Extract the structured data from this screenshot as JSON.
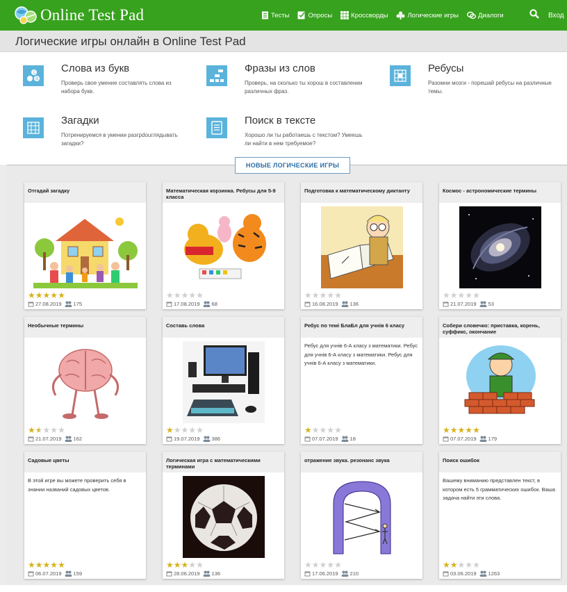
{
  "header": {
    "logo_text": "Online Test Pad",
    "nav": [
      {
        "label": "Тесты",
        "icon": "document-icon"
      },
      {
        "label": "Опросы",
        "icon": "poll-icon"
      },
      {
        "label": "Кроссворды",
        "icon": "grid-icon"
      },
      {
        "label": "Логические игры",
        "icon": "puzzle-icon"
      },
      {
        "label": "Диалоги",
        "icon": "dialog-icon"
      }
    ],
    "search_icon": "search-icon",
    "login_label": "Вход"
  },
  "page_title": "Логические игры онлайн в Online Test Pad",
  "categories": [
    {
      "title": "Слова из букв",
      "desc": "Проверь свое умение составлять слова из набора букв.",
      "icon": "letters-icon"
    },
    {
      "title": "Фразы из слов",
      "desc": "Проверь, на сколько ты хорош в составлении различных фраз.",
      "icon": "phrases-icon"
    },
    {
      "title": "Ребусы",
      "desc": "Разомни мозги - порешай ребусы на различные темы.",
      "icon": "rebus-icon"
    },
    {
      "title": "Загадки",
      "desc": "Потренируемся в умении разгрdouглядывать загадки?",
      "icon": "riddle-icon"
    },
    {
      "title": "Поиск в тексте",
      "desc": "Хорошо ли ты работаешь с текстом? Умеешь ли найти в нем требуемое?",
      "icon": "text-search-icon"
    }
  ],
  "new_games_label": "НОВЫЕ ЛОГИЧЕСКИЕ ИГРЫ",
  "games": [
    {
      "title": "Отгадай загадку",
      "image": "house-family-drawing",
      "text": "",
      "rating": 5,
      "date": "27.08.2019",
      "count": "175"
    },
    {
      "title": "Математическая корзинка. Ребусы для 5-9 класса",
      "image": "pooh-tigger-drawing",
      "text": "",
      "rating": 0,
      "date": "17.08.2019",
      "count": "68"
    },
    {
      "title": "Подготовка к математическому диктанту",
      "image": "thinking-man-drawing",
      "text": "",
      "rating": 0,
      "date": "16.08.2019",
      "count": "136"
    },
    {
      "title": "Космос - астрономические термины",
      "image": "galaxy-photo",
      "text": "",
      "rating": 0,
      "date": "21.07.2019",
      "count": "53"
    },
    {
      "title": "Необычные термины",
      "image": "brain-character",
      "text": "",
      "rating": 1.5,
      "date": "21.07.2019",
      "count": "162"
    },
    {
      "title": "Составь слова",
      "image": "computer-photo",
      "text": "",
      "rating": 1,
      "date": "19.07.2019",
      "count": "386"
    },
    {
      "title": "Ребус по темі БлаБл для учнів 6 класу",
      "image": "",
      "text": "Ребус для учнів 6-А класу з математики. Ребус для учнів 6-А класу з математики. Ребус для учнів 6-А класу з математики.",
      "rating": 1,
      "date": "07.07.2019",
      "count": "18"
    },
    {
      "title": "Собери словечко: приставка, корень, суффикс, окончание",
      "image": "builder-drawing",
      "text": "",
      "rating": 5,
      "date": "07.07.2019",
      "count": "179"
    },
    {
      "title": "Садовые цветы",
      "image": "",
      "text": "В этой игре вы можете проверить себя в знании названий садовых цветов.",
      "rating": 5,
      "date": "06.07.2019",
      "count": "159"
    },
    {
      "title": "Логическая игра с математическими терминами",
      "image": "paper-football-photo",
      "text": "",
      "rating": 3,
      "date": "28.06.2019",
      "count": "136"
    },
    {
      "title": "отражение звука. резонанс звука",
      "image": "sound-arch-diagram",
      "text": "",
      "rating": 0,
      "date": "17.06.2019",
      "count": "210"
    },
    {
      "title": "Поиск ошибок",
      "image": "",
      "text": "Вашему вниманию представлен текст, в котором есть 5 грамматических ошибок. Ваша задача найти эти слова.",
      "rating": 2,
      "date": "03.06.2019",
      "count": "1263"
    }
  ],
  "colors": {
    "header_green": "#37a21d",
    "accent_blue": "#5bb3dc",
    "star": "#d5b31c",
    "button_blue": "#2a6ca3"
  }
}
